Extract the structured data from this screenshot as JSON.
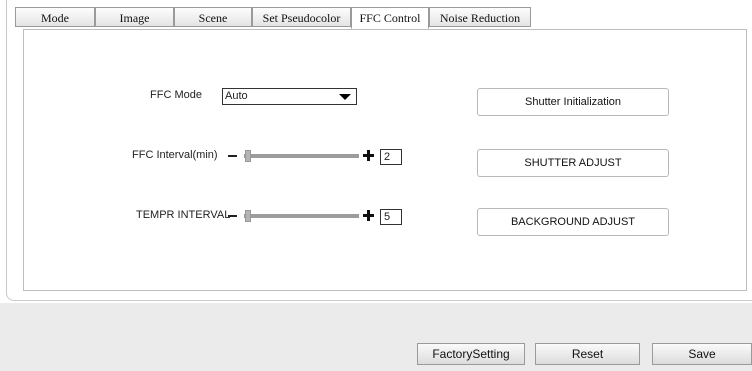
{
  "tabs": [
    {
      "label": "Mode"
    },
    {
      "label": "Image"
    },
    {
      "label": "Scene"
    },
    {
      "label": "Set Pseudocolor"
    },
    {
      "label": "FFC Control"
    },
    {
      "label": "Noise Reduction"
    }
  ],
  "active_tab": "FFC Control",
  "ffc_mode": {
    "label": "FFC Mode",
    "value": "Auto"
  },
  "ffc_interval": {
    "label": "FFC Interval(min)",
    "value": "2"
  },
  "tempr_interval": {
    "label": "TEMPR INTERVAL",
    "value": "5"
  },
  "buttons": {
    "shutter_init": "Shutter Initialization",
    "shutter_adjust": "SHUTTER ADJUST",
    "background_adjust": "BACKGROUND ADJUST"
  },
  "footer": {
    "factory": "FactorySetting",
    "reset": "Reset",
    "save": "Save"
  }
}
